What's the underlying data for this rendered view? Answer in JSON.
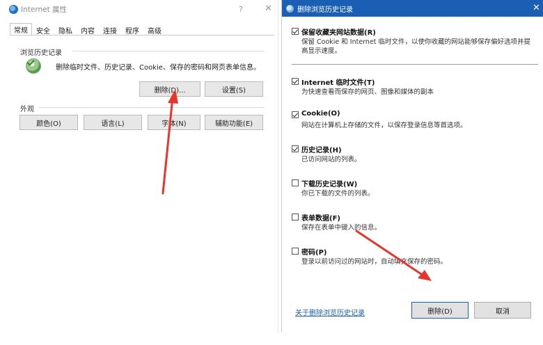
{
  "left_dialog": {
    "title": "Internet 属性",
    "help_glyph": "?",
    "close_glyph": "✕",
    "tabs": [
      {
        "label": "常规",
        "active": true
      },
      {
        "label": "安全",
        "active": false
      },
      {
        "label": "隐私",
        "active": false
      },
      {
        "label": "内容",
        "active": false
      },
      {
        "label": "连接",
        "active": false
      },
      {
        "label": "程序",
        "active": false
      },
      {
        "label": "高级",
        "active": false
      }
    ],
    "history_group": {
      "label": "浏览历史记录",
      "description": "删除临时文件、历史记录、Cookie、保存的密码和网页表单信息。",
      "delete_button": "删除(D)...",
      "settings_button": "设置(S)"
    },
    "appearance_group": {
      "label": "外观",
      "buttons": [
        "颜色(O)",
        "语言(L)",
        "字体(N)",
        "辅助功能(E)"
      ]
    }
  },
  "right_dialog": {
    "title": "删除浏览历史记录",
    "close_glyph": "✕",
    "options": [
      {
        "name": "保留收藏夹网站数据(R)",
        "desc": "保留 Cookie 和 Internet 临时文件，以使你收藏的网站能够保存偏好选项并提高显示速度。",
        "checked": true
      },
      {
        "name": "Internet 临时文件(T)",
        "desc": "为快速查看而保存的网页、图像和媒体的副本",
        "checked": true
      },
      {
        "name": "Cookie(O)",
        "desc": "网站在计算机上存储的文件，以保存登录信息等首选项。",
        "checked": true
      },
      {
        "name": "历史记录(H)",
        "desc": "已访问网站的列表。",
        "checked": true
      },
      {
        "name": "下载历史记录(W)",
        "desc": "你已下载的文件的列表。",
        "checked": false
      },
      {
        "name": "表单数据(F)",
        "desc": "保存在表单中键入的信息。",
        "checked": false
      },
      {
        "name": "密码(P)",
        "desc": "登录以前访问过的网站时，自动填充保存的密码。",
        "checked": false
      }
    ],
    "about_link": "关于删除浏览历史记录",
    "delete_button": "删除(D)",
    "cancel_button": "取消"
  },
  "colors": {
    "title_bar": "#1a5fb4",
    "link": "#1a5fb4",
    "annotation_arrow": "#e8352b"
  }
}
